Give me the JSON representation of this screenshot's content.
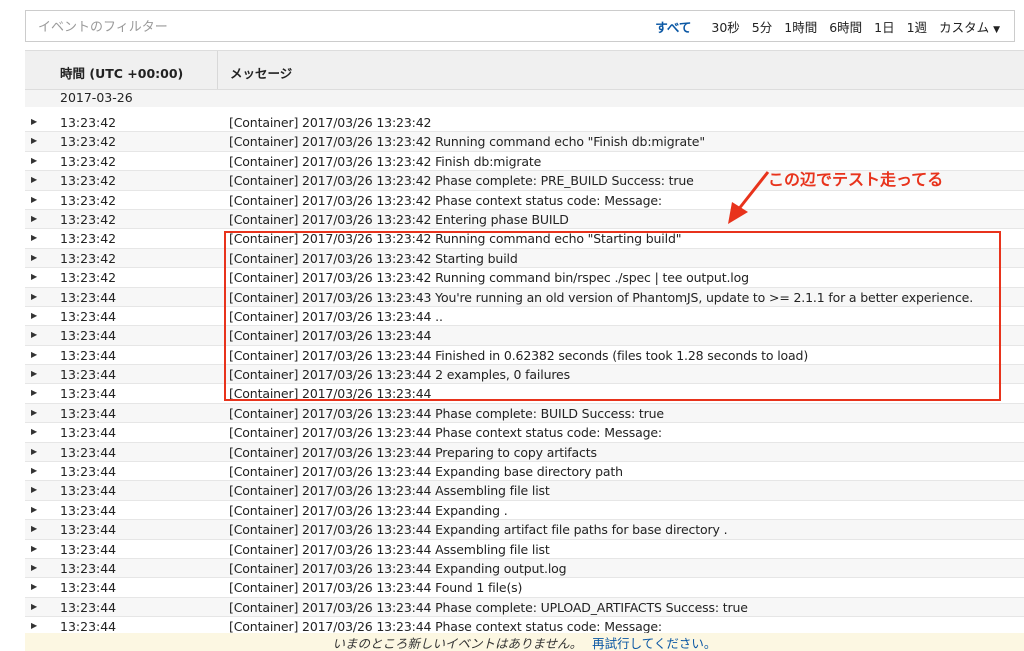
{
  "toolbar": {
    "filter_placeholder": "イベントのフィルター",
    "ranges": [
      {
        "label": "すべて",
        "active": true
      },
      {
        "label": "30秒"
      },
      {
        "label": "5分"
      },
      {
        "label": "1時間"
      },
      {
        "label": "6時間"
      },
      {
        "label": "1日"
      },
      {
        "label": "1週"
      },
      {
        "label": "カスタム"
      }
    ]
  },
  "table": {
    "col_time": "時間 (UTC +00:00)",
    "col_message": "メッセージ",
    "date_group": "2017-03-26",
    "rows": [
      {
        "time": "13:23:42",
        "message": "[Container] 2017/03/26 13:23:42"
      },
      {
        "time": "13:23:42",
        "message": "[Container] 2017/03/26 13:23:42 Running command echo \"Finish db:migrate\""
      },
      {
        "time": "13:23:42",
        "message": "[Container] 2017/03/26 13:23:42 Finish db:migrate"
      },
      {
        "time": "13:23:42",
        "message": "[Container] 2017/03/26 13:23:42 Phase complete: PRE_BUILD Success: true"
      },
      {
        "time": "13:23:42",
        "message": "[Container] 2017/03/26 13:23:42 Phase context status code: Message:"
      },
      {
        "time": "13:23:42",
        "message": "[Container] 2017/03/26 13:23:42 Entering phase BUILD"
      },
      {
        "time": "13:23:42",
        "message": "[Container] 2017/03/26 13:23:42 Running command echo \"Starting build\""
      },
      {
        "time": "13:23:42",
        "message": "[Container] 2017/03/26 13:23:42 Starting build"
      },
      {
        "time": "13:23:42",
        "message": "[Container] 2017/03/26 13:23:42 Running command bin/rspec ./spec | tee output.log"
      },
      {
        "time": "13:23:44",
        "message": "[Container] 2017/03/26 13:23:43 You're running an old version of PhantomJS, update to >= 2.1.1 for a better experience."
      },
      {
        "time": "13:23:44",
        "message": "[Container] 2017/03/26 13:23:44 .."
      },
      {
        "time": "13:23:44",
        "message": "[Container] 2017/03/26 13:23:44"
      },
      {
        "time": "13:23:44",
        "message": "[Container] 2017/03/26 13:23:44 Finished in 0.62382 seconds (files took 1.28 seconds to load)"
      },
      {
        "time": "13:23:44",
        "message": "[Container] 2017/03/26 13:23:44 2 examples, 0 failures"
      },
      {
        "time": "13:23:44",
        "message": "[Container] 2017/03/26 13:23:44"
      },
      {
        "time": "13:23:44",
        "message": "[Container] 2017/03/26 13:23:44 Phase complete: BUILD Success: true"
      },
      {
        "time": "13:23:44",
        "message": "[Container] 2017/03/26 13:23:44 Phase context status code: Message:"
      },
      {
        "time": "13:23:44",
        "message": "[Container] 2017/03/26 13:23:44 Preparing to copy artifacts"
      },
      {
        "time": "13:23:44",
        "message": "[Container] 2017/03/26 13:23:44 Expanding base directory path"
      },
      {
        "time": "13:23:44",
        "message": "[Container] 2017/03/26 13:23:44 Assembling file list"
      },
      {
        "time": "13:23:44",
        "message": "[Container] 2017/03/26 13:23:44 Expanding ."
      },
      {
        "time": "13:23:44",
        "message": "[Container] 2017/03/26 13:23:44 Expanding artifact file paths for base directory ."
      },
      {
        "time": "13:23:44",
        "message": "[Container] 2017/03/26 13:23:44 Assembling file list"
      },
      {
        "time": "13:23:44",
        "message": "[Container] 2017/03/26 13:23:44 Expanding output.log"
      },
      {
        "time": "13:23:44",
        "message": "[Container] 2017/03/26 13:23:44 Found 1 file(s)"
      },
      {
        "time": "13:23:44",
        "message": "[Container] 2017/03/26 13:23:44 Phase complete: UPLOAD_ARTIFACTS Success: true"
      },
      {
        "time": "13:23:44",
        "message": "[Container] 2017/03/26 13:23:44 Phase context status code: Message:"
      }
    ]
  },
  "annotation": {
    "text": "この辺でテスト走ってる",
    "color": "#e8331c"
  },
  "footer": {
    "message": "いまのところ新しいイベントはありません。",
    "retry_link": "再試行してください。"
  },
  "icons": {
    "row_expand": "triangle-right-icon",
    "dropdown": "caret-down-icon"
  }
}
